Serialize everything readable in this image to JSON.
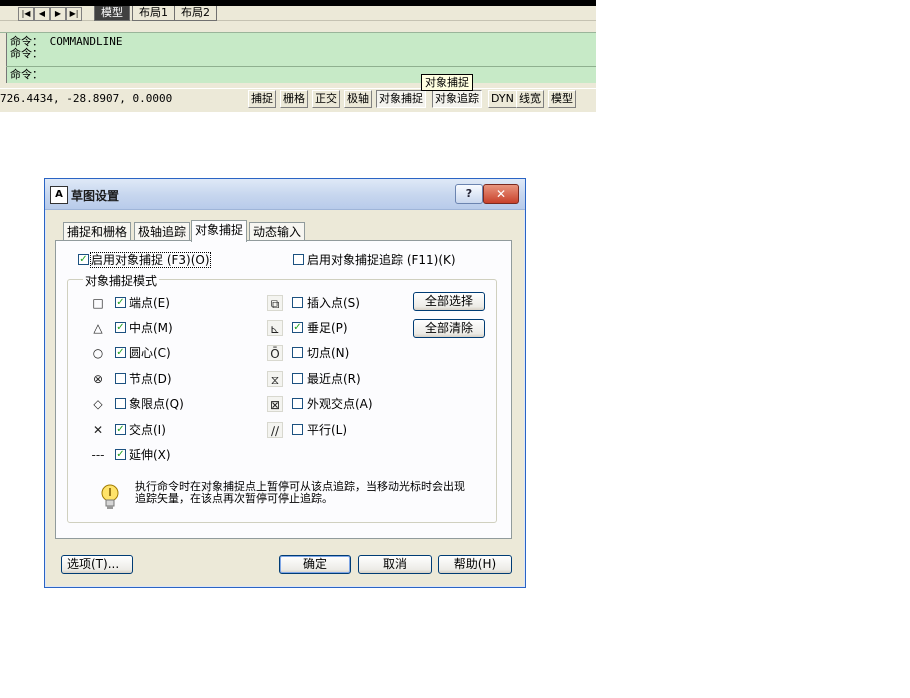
{
  "cad": {
    "layout_tabs": [
      "模型",
      "布局1",
      "布局2"
    ],
    "nav_buttons": [
      "|◀",
      "◀",
      "▶",
      "▶|"
    ],
    "command_lines": [
      "命令： COMMANDLINE",
      "命令：",
      "命令："
    ],
    "tooltip": "对象捕捉",
    "coordinates": "726.4434, -28.8907, 0.0000",
    "status_buttons": [
      "捕捉",
      "栅格",
      "正交",
      "极轴",
      "对象捕捉",
      "对象追踪",
      "DYN",
      "线宽",
      "模型"
    ]
  },
  "dialog": {
    "title": "草图设置",
    "help_button": "?",
    "close_button": "✕",
    "tabs": [
      "捕捉和栅格",
      "极轴追踪",
      "对象捕捉",
      "动态输入"
    ],
    "active_tab": "对象捕捉",
    "enable_osnap": {
      "label": "启用对象捕捉 (F3)(O)",
      "checked": true
    },
    "enable_tracking": {
      "label": "启用对象捕捉追踪 (F11)(K)",
      "checked": false
    },
    "group_title": "对象捕捉模式",
    "left_modes": [
      {
        "symbol": "□",
        "label": "端点(E)",
        "checked": true
      },
      {
        "symbol": "△",
        "label": "中点(M)",
        "checked": true
      },
      {
        "symbol": "○",
        "label": "圆心(C)",
        "checked": true
      },
      {
        "symbol": "⊗",
        "label": "节点(D)",
        "checked": false
      },
      {
        "symbol": "◇",
        "label": "象限点(Q)",
        "checked": false
      },
      {
        "symbol": "✕",
        "label": "交点(I)",
        "checked": true
      },
      {
        "symbol": "---",
        "label": "延伸(X)",
        "checked": true
      }
    ],
    "right_modes": [
      {
        "symbol": "⧉",
        "label": "插入点(S)",
        "checked": false
      },
      {
        "symbol": "⊾",
        "label": "垂足(P)",
        "checked": true
      },
      {
        "symbol": "Ō",
        "label": "切点(N)",
        "checked": false
      },
      {
        "symbol": "⧖",
        "label": "最近点(R)",
        "checked": false
      },
      {
        "symbol": "⊠",
        "label": "外观交点(A)",
        "checked": false
      },
      {
        "symbol": "∕∕",
        "label": "平行(L)",
        "checked": false
      }
    ],
    "select_all": "全部选择",
    "clear_all": "全部清除",
    "hint": "执行命令时在对象捕捉点上暂停可从该点追踪，当移动光标时会出现追踪矢量，在该点再次暂停可停止追踪。",
    "options_button": "选项(T)...",
    "ok_button": "确定",
    "cancel_button": "取消",
    "help_footer_button": "帮助(H)",
    "check_mark": "✓"
  }
}
